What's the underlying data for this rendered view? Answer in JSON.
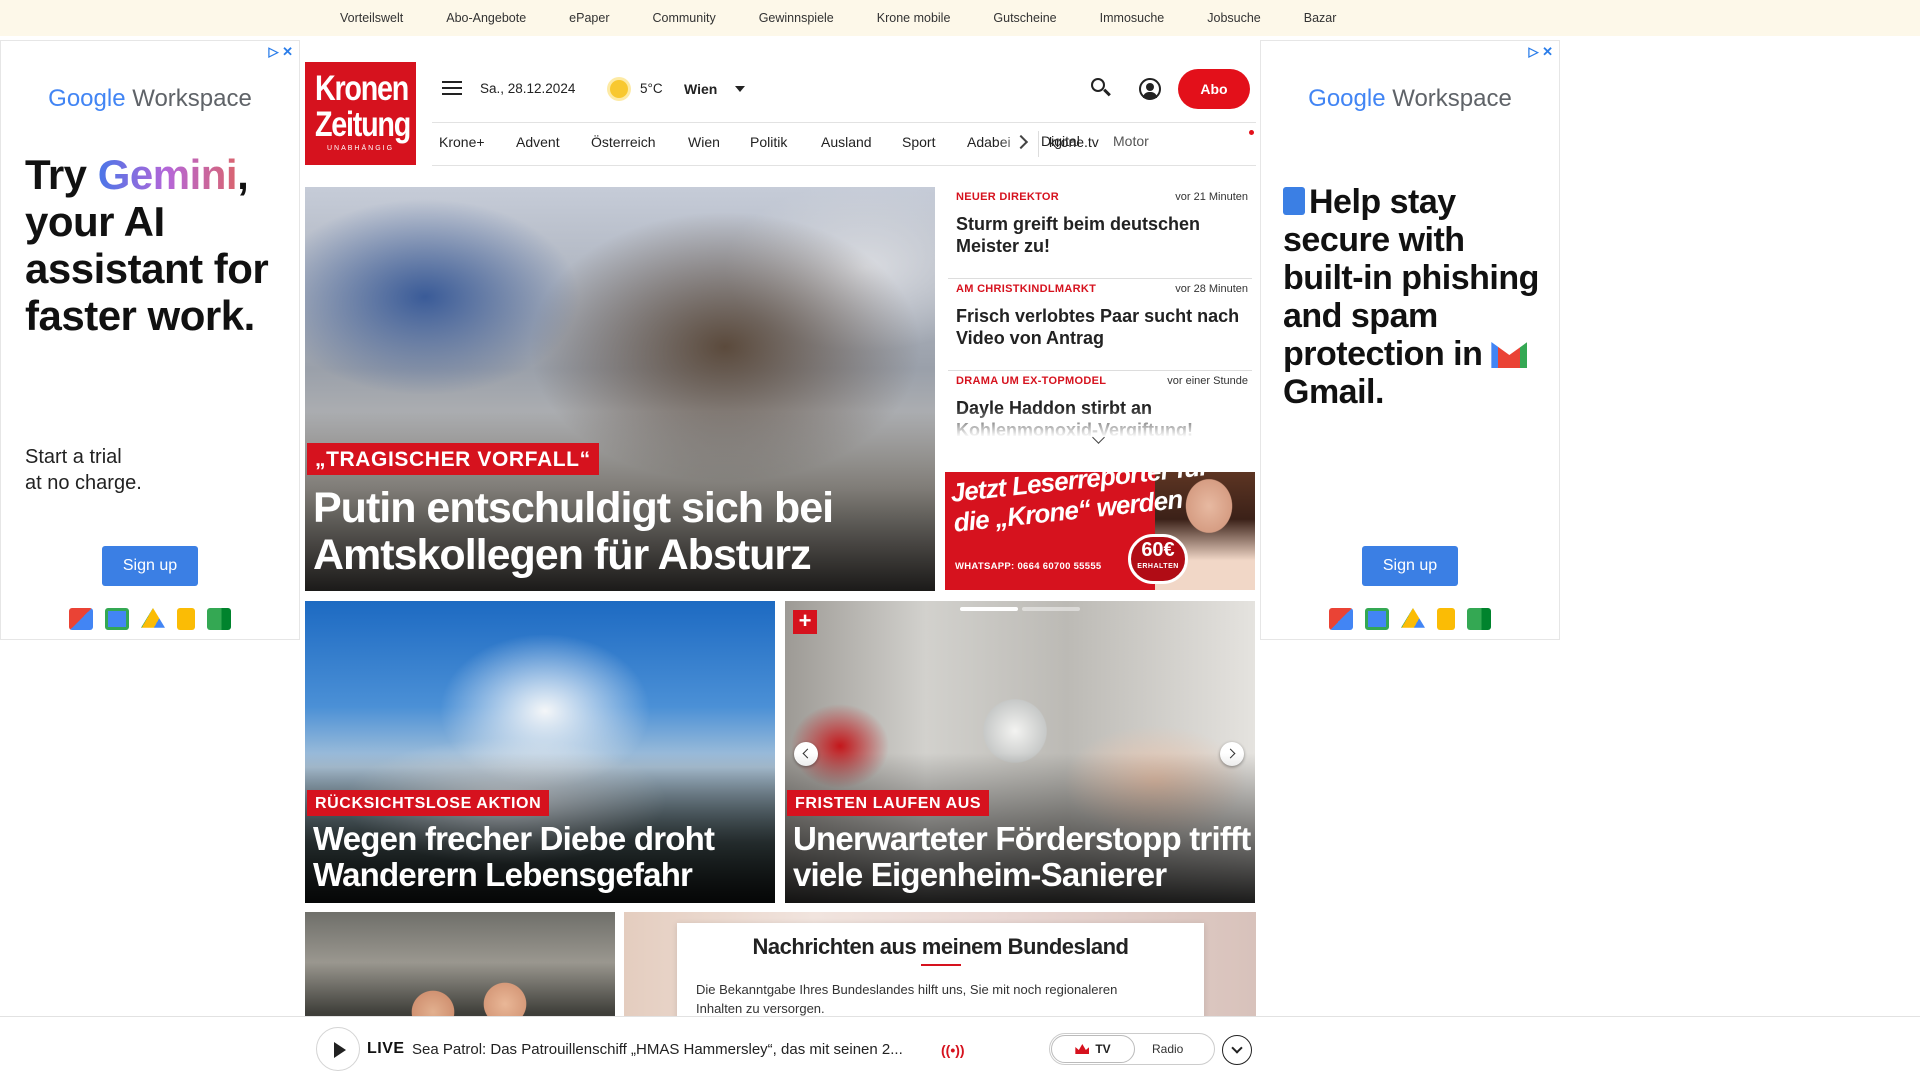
{
  "topbar": {
    "links": [
      "Vorteilswelt",
      "Abo-Angebote",
      "ePaper",
      "Community",
      "Gewinnspiele",
      "Krone mobile",
      "Gutscheine",
      "Immosuche",
      "Jobsuche",
      "Bazar"
    ]
  },
  "ad_left": {
    "ad_choices": "▷ ✕",
    "brand_google": "Google",
    "brand_product": "Workspace",
    "headline_try": "Try",
    "headline_gemini": "Gemini",
    "headline_rest": ", your AI assistant for faster work.",
    "subtext": "Start a trial\nat no charge.",
    "cta": "Sign up"
  },
  "ad_right": {
    "ad_choices": "▷ ✕",
    "brand_google": "Google",
    "brand_product": "Workspace",
    "headline": "Help stay secure with built-in phishing and spam protection in",
    "headline_gmail": "Gmail.",
    "cta": "Sign up"
  },
  "header": {
    "logo_line1": "Kronen",
    "logo_line2": "Zeitung",
    "logo_tagline": "UNABHÄNGIG",
    "date": "Sa., 28.12.2024",
    "temperature": "5°C",
    "city": "Wien",
    "abo_label": "Abo"
  },
  "nav": {
    "items": [
      "Krone+",
      "Advent",
      "Österreich",
      "Wien",
      "Politik",
      "Ausland",
      "Sport",
      "Adabei",
      "Digital",
      "Motor"
    ],
    "tv": "krone.tv"
  },
  "hero": {
    "kicker": "„TRAGISCHER VORFALL“",
    "title": "Putin entschuldigt sich bei Amtskollegen für Absturz"
  },
  "side_news": [
    {
      "category": "NEUER DIREKTOR",
      "time": "vor 21 Minuten",
      "title": "Sturm greift beim deutschen Meister zu!"
    },
    {
      "category": "AM CHRISTKINDLMARKT",
      "time": "vor 28 Minuten",
      "title": "Frisch verlobtes Paar sucht nach Video von Antrag"
    },
    {
      "category": "DRAMA UM EX-TOPMODEL",
      "time": "vor einer Stunde",
      "title": "Dayle Haddon stirbt an Kohlenmonoxid-Vergiftung!"
    }
  ],
  "leserreporter": {
    "headline": "Jetzt Leserreporter für die „Krone“ werden",
    "whatsapp": "WHATSAPP: 0664 60700 55555",
    "badge_value": "60€",
    "badge_unit": "ERHALTEN"
  },
  "cards": [
    {
      "kicker": "RÜCKSICHTSLOSE AKTION",
      "title": "Wegen frecher Diebe droht Wanderern Lebensgefahr"
    },
    {
      "kicker": "FRISTEN LAUFEN AUS",
      "title": "Unerwarteter Förderstopp trifft viele Eigenheim-Sanierer",
      "plus": "+"
    }
  ],
  "bundesland": {
    "title": "Nachrichten aus meinem Bundesland",
    "text": "Die Bekanntgabe Ihres Bundeslandes hilft uns, Sie mit noch regionaleren Inhalten zu versorgen."
  },
  "player": {
    "live": "LIVE",
    "title": "Sea Patrol: Das Patrouillenschiff „HMAS Hammersley“, das mit seinen 2...",
    "radio_icon": "((•))",
    "tv_label": "TV",
    "radio_label": "Radio"
  },
  "colors": {
    "brand_red": "#d6121e",
    "topbar_bg": "#fdf8e9",
    "google_blue": "#3b7fe4"
  }
}
